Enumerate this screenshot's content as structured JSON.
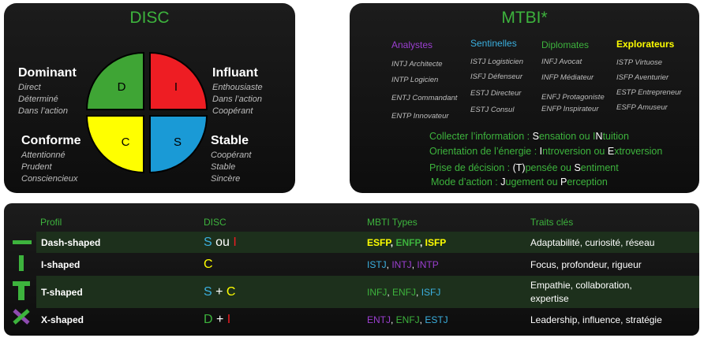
{
  "disc": {
    "title": "DISC",
    "quadrants": {
      "d": "D",
      "i": "I",
      "c": "C",
      "s": "S"
    },
    "colors": {
      "d": "#3fa535",
      "i": "#ee1d23",
      "c": "#ffff00",
      "s": "#1a9ad6"
    },
    "dominant": {
      "title": "Dominant",
      "traits": [
        "Direct",
        "Déterminé",
        "Dans l’action"
      ]
    },
    "influant": {
      "title": "Influant",
      "traits": [
        "Enthousiaste",
        "Dans l’action",
        "Coopérant"
      ]
    },
    "conforme": {
      "title": "Conforme",
      "traits": [
        "Attentionné",
        "Prudent",
        "Consciencieux"
      ]
    },
    "stable": {
      "title": "Stable",
      "traits": [
        "Coopérant",
        "Stable",
        "Sincère"
      ]
    }
  },
  "mbti": {
    "title": "MTBI*",
    "groups": [
      {
        "name": "Analystes",
        "color": "#9b3fd0",
        "types": [
          "INTJ Architecte",
          "INTP Logicien",
          "ENTJ Commandant",
          "ENTP Innovateur"
        ]
      },
      {
        "name": "Sentinelles",
        "color": "#3bb0e0",
        "types": [
          "ISTJ Logisticien",
          "ISFJ Défenseur",
          "ESTJ Directeur",
          "ESTJ Consul"
        ]
      },
      {
        "name": "Diplomates",
        "color": "#3db33d",
        "types": [
          "INFJ Avocat",
          "INFP Médiateur",
          "ENFJ Protagoniste",
          "ENFP Inspirateur"
        ]
      },
      {
        "name": "Explorateurs",
        "color": "#ffff00",
        "types": [
          "ISTP Virtuose",
          "ISFP Aventurier",
          "ESTP Entrepreneur",
          "ESFP Amuseur"
        ]
      }
    ],
    "dimensions": [
      [
        "Collecter l’information : ",
        "S",
        "ensation ou I",
        "N",
        "tuition"
      ],
      [
        "Orientation de l’énergie : ",
        "I",
        "ntroversion  ou ",
        "E",
        "xtroversion"
      ],
      [
        "Prise de décision : ",
        "(T)",
        "pensée  ou ",
        "S",
        "entiment"
      ],
      [
        "Mode d’action : ",
        "J",
        "ugement  ou ",
        "P",
        "erception"
      ]
    ]
  },
  "table": {
    "headers": [
      "Profil",
      "DISC",
      "MBTI Types",
      "Traits clés"
    ],
    "rows": [
      {
        "profile": "Dash-shaped",
        "disc": [
          [
            "S",
            "#3bb0e0"
          ],
          [
            " ou ",
            "#ffffff"
          ],
          [
            "I",
            "#ee1d23"
          ]
        ],
        "mbti": [
          [
            "ESFP",
            "#ffff00"
          ],
          [
            ", ",
            "#ffffff"
          ],
          [
            "ENFP",
            "#3db33d"
          ],
          [
            ", ",
            "#ffffff"
          ],
          [
            "ISFP",
            "#ffff00"
          ]
        ],
        "traits": "Adaptabilité, curiosité, réseau"
      },
      {
        "profile": "I-shaped",
        "disc": [
          [
            "C",
            "#ffff00"
          ]
        ],
        "mbti": [
          [
            "ISTJ",
            "#3bb0e0"
          ],
          [
            ", ",
            "#ffffff"
          ],
          [
            "INTJ",
            "#9b3fd0"
          ],
          [
            ", ",
            "#ffffff"
          ],
          [
            "INTP",
            "#9b3fd0"
          ]
        ],
        "traits": "Focus, profondeur, rigueur"
      },
      {
        "profile": "T-shaped",
        "disc": [
          [
            "S",
            "#3bb0e0"
          ],
          [
            " + ",
            "#ffffff"
          ],
          [
            "C",
            "#ffff00"
          ]
        ],
        "mbti": [
          [
            "INFJ",
            "#3db33d"
          ],
          [
            ", ",
            "#ffffff"
          ],
          [
            "ENFJ",
            "#3db33d"
          ],
          [
            ", ",
            "#ffffff"
          ],
          [
            "ISFJ",
            "#3bb0e0"
          ]
        ],
        "traits": "Empathie, collaboration,\nexpertise"
      },
      {
        "profile": "X-shaped",
        "disc": [
          [
            "D",
            "#3db33d"
          ],
          [
            " + ",
            "#ffffff"
          ],
          [
            "I",
            "#ee1d23"
          ]
        ],
        "mbti": [
          [
            "ENTJ",
            "#9b3fd0"
          ],
          [
            ", ",
            "#ffffff"
          ],
          [
            "ENFJ",
            "#3db33d"
          ],
          [
            ", ",
            "#ffffff"
          ],
          [
            "ESTJ",
            "#3bb0e0"
          ]
        ],
        "traits": "Leadership, influence, stratégie"
      }
    ]
  }
}
